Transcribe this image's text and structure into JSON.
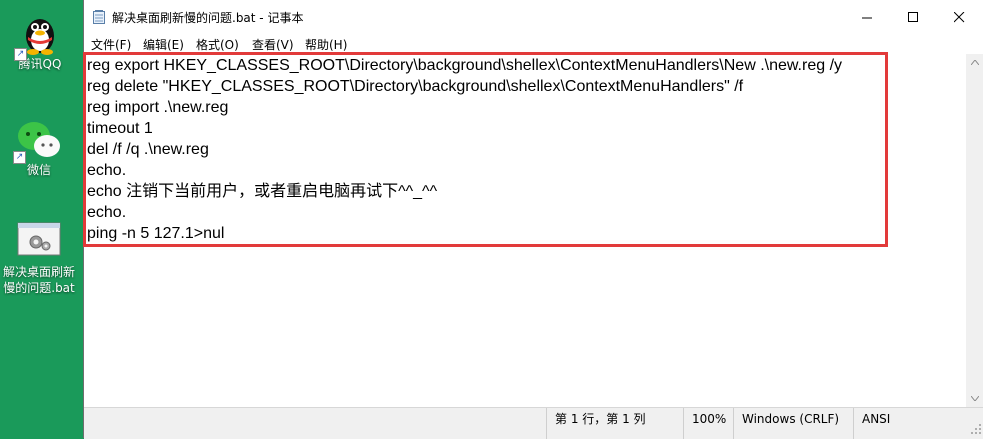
{
  "desktop": {
    "icons": [
      {
        "label": "腾讯QQ"
      },
      {
        "label": "微信"
      },
      {
        "label": "解决桌面刷新慢的问题.bat"
      }
    ]
  },
  "window": {
    "title": "解决桌面刷新慢的问题.bat - 记事本"
  },
  "menu": [
    {
      "label": "文件(F)"
    },
    {
      "label": "编辑(E)"
    },
    {
      "label": "格式(O)"
    },
    {
      "label": "查看(V)"
    },
    {
      "label": "帮助(H)"
    }
  ],
  "editor": {
    "lines": [
      "reg export HKEY_CLASSES_ROOT\\Directory\\background\\shellex\\ContextMenuHandlers\\New .\\new.reg /y",
      "reg delete \"HKEY_CLASSES_ROOT\\Directory\\background\\shellex\\ContextMenuHandlers\" /f",
      "reg import .\\new.reg",
      "timeout 1",
      "del /f /q .\\new.reg",
      "echo.",
      "echo 注销下当前用户，或者重启电脑再试下^^_^^",
      "echo.",
      "ping -n 5 127.1>nul"
    ],
    "highlight_color": "#e23a3a"
  },
  "statusbar": {
    "position": "第 1 行，第 1 列",
    "zoom": "100%",
    "line_ending": "Windows (CRLF)",
    "encoding": "ANSI"
  },
  "colors": {
    "desktop_bg": "#1a9a5a",
    "window_bg": "#ffffff",
    "statusbar_bg": "#f0f0f0"
  }
}
